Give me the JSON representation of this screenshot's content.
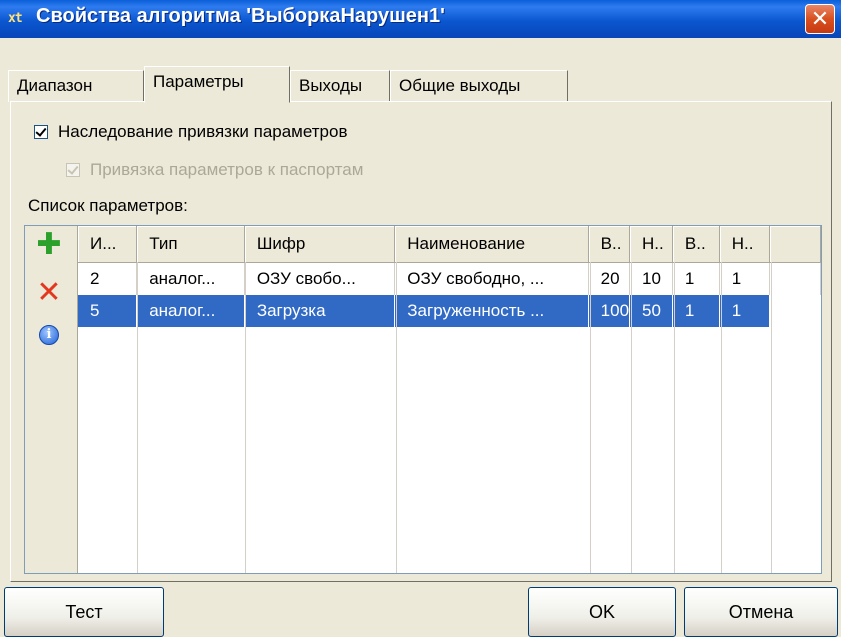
{
  "window": {
    "icon": "xt",
    "title": "Свойства алгоритма 'ВыборкаНарушен1'",
    "close_glyph": "✕"
  },
  "tabs": [
    "Диапазон",
    "Параметры",
    "Выходы",
    "Общие выходы"
  ],
  "active_tab": "Параметры",
  "options": {
    "inherit_binding_label": "Наследование привязки параметров",
    "inherit_binding_checked": true,
    "passport_binding_label": "Привязка параметров к паспортам",
    "passport_binding_checked": true,
    "passport_binding_disabled": true
  },
  "params_list": {
    "label": "Список параметров:",
    "toolbar": [
      {
        "name": "add-icon",
        "glyph": "✚"
      },
      {
        "name": "delete-icon",
        "glyph": "✕"
      },
      {
        "name": "info-icon",
        "glyph": "i"
      }
    ],
    "columns": [
      "И...",
      "Тип",
      "Шифр",
      "Наименование",
      "В..",
      "Н..",
      "В..",
      "Н.."
    ],
    "rows": [
      {
        "cells": [
          "2",
          "аналог...",
          "ОЗУ свобо...",
          "ОЗУ свободно, ...",
          "20",
          "10",
          "1",
          "1"
        ],
        "selected": false
      },
      {
        "cells": [
          "5",
          "аналог...",
          "Загрузка",
          "Загруженность ...",
          "100",
          "50",
          "1",
          "1"
        ],
        "selected": true
      }
    ]
  },
  "buttons": {
    "test": "Тест",
    "ok": "OK",
    "cancel": "Отмена"
  },
  "colors": {
    "title_bar": "#0A57D0",
    "selection": "#316AC5",
    "dialog_bg": "#ECE9D8"
  }
}
